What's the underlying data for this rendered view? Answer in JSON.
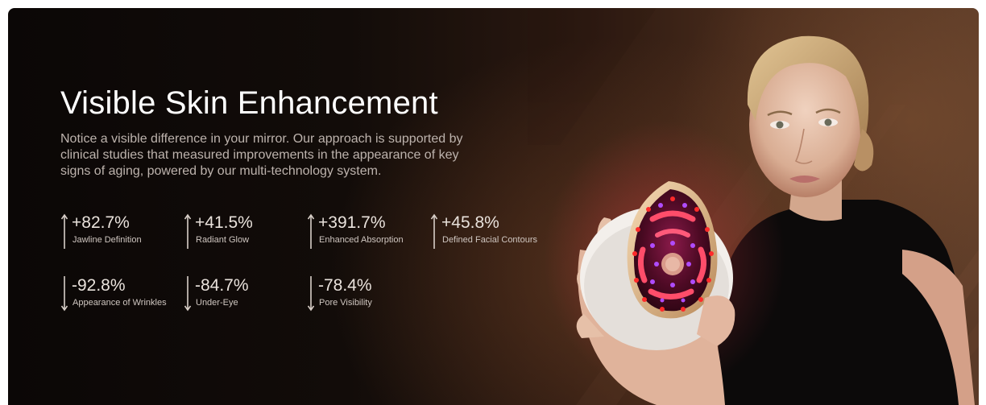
{
  "hero": {
    "title": "Visible Skin Enhancement",
    "description": "Notice a visible difference in your mirror. Our approach is supported by clinical studies that measured improvements in the appearance of key signs of aging, powered by our multi-technology system."
  },
  "stats": [
    {
      "value": "+82.7%",
      "label": "Jawline Definition",
      "direction": "up"
    },
    {
      "value": "+41.5%",
      "label": "Radiant Glow",
      "direction": "up"
    },
    {
      "value": "+391.7%",
      "label": "Enhanced Absorption",
      "direction": "up"
    },
    {
      "value": "+45.8%",
      "label": "Defined Facial Contours",
      "direction": "up"
    },
    {
      "value": "-92.8%",
      "label": "Appearance of Wrinkles",
      "direction": "down"
    },
    {
      "value": "-84.7%",
      "label": "Under-Eye",
      "direction": "down"
    },
    {
      "value": "-78.4%",
      "label": "Pore Visibility",
      "direction": "down"
    }
  ],
  "colors": {
    "background_dark": "#0b0706",
    "background_warm": "#5a3a27",
    "title": "#ffffff",
    "text": "#bdb3ad",
    "led_red": "#ff2a2a",
    "led_purple": "#a020f0"
  },
  "icons": {
    "up": "arrow-up-icon",
    "down": "arrow-down-icon"
  }
}
